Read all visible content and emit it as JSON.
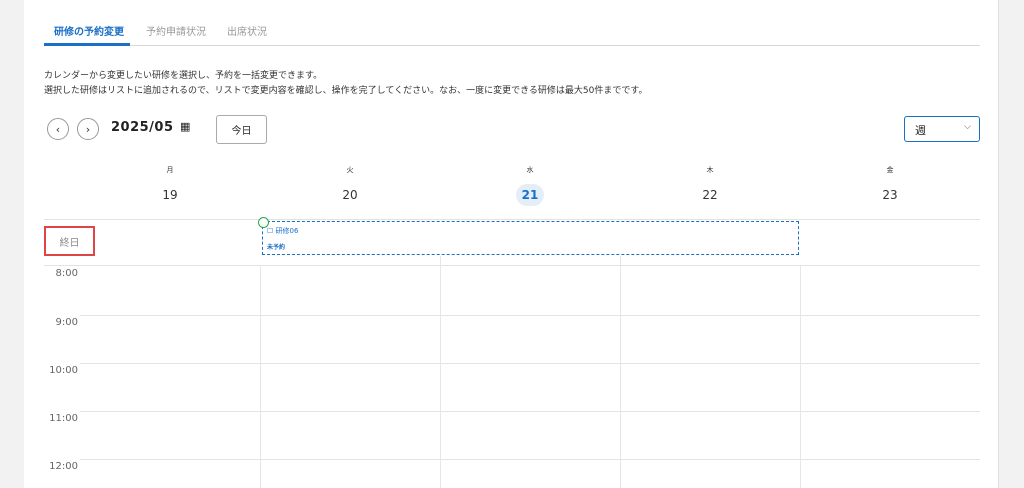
{
  "tabs": [
    {
      "label": "研修の予約変更"
    },
    {
      "label": "予約申請状況"
    },
    {
      "label": "出席状況"
    }
  ],
  "description": {
    "line1": "カレンダーから変更したい研修を選択し、予約を一括変更できます。",
    "line2": "選択した研修はリストに追加されるので、リストで変更内容を確認し、操作を完了してください。なお、一度に変更できる研修は最大50件までです。"
  },
  "toolbar": {
    "prev_icon": "‹",
    "next_icon": "›",
    "month": "2025/05",
    "calendar_icon": "▦",
    "today_label": "今日",
    "view_value": "週",
    "view_chevron": "⌵"
  },
  "calendar": {
    "days": [
      {
        "dow": "月",
        "date": "19"
      },
      {
        "dow": "火",
        "date": "20"
      },
      {
        "dow": "水",
        "date": "21",
        "today": true
      },
      {
        "dow": "木",
        "date": "22"
      },
      {
        "dow": "金",
        "date": "23"
      }
    ],
    "allday_label": "終日",
    "event": {
      "icon": "☐",
      "title": "研修06",
      "status": "未予約"
    },
    "times": [
      "8:00",
      "9:00",
      "10:00",
      "11:00",
      "12:00"
    ]
  },
  "colors": {
    "accent": "#1a6fc7",
    "highlight_border": "#e04545",
    "drag_handle": "#2aa84a"
  }
}
